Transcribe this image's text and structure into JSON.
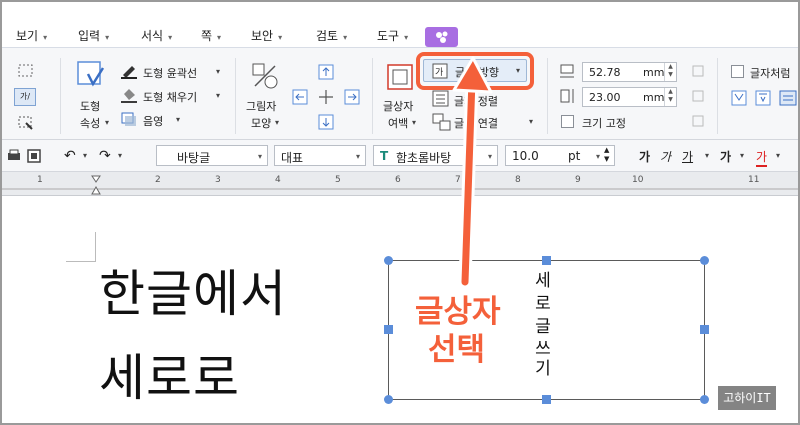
{
  "menu": {
    "items": [
      "보기",
      "입력",
      "서식",
      "쪽",
      "보안",
      "검토",
      "도구"
    ],
    "magic_icon": "magic-wand-icon"
  },
  "ribbon": {
    "shape_props": {
      "line1": "도형",
      "line2": "속성"
    },
    "outline_label": "도형 윤곽선",
    "fill_label": "도형 채우기",
    "shadow_label": "음영",
    "picture_shape": {
      "line1": "그림자",
      "line2": "모양"
    },
    "textbox_margin": {
      "line1": "글상자",
      "line2": "여백"
    },
    "text_direction_label": "글자 방향",
    "text_align_label": "글자 정렬",
    "text_link_label": "글자 연결",
    "width": {
      "value": "52.78",
      "unit": "mm"
    },
    "height": {
      "value": "23.00",
      "unit": "mm"
    },
    "fix_size_label": "크기 고정",
    "treat_as_char_label": "글자처럼"
  },
  "format": {
    "style": "바탕글",
    "language": "대표",
    "font": "함초롬바탕",
    "size": "10.0",
    "size_unit": "pt",
    "char_a": "가",
    "char_b": "가",
    "char_c": "가",
    "char_d": "가",
    "char_e": "가"
  },
  "ruler": {
    "numbers": [
      "1",
      "2",
      "3",
      "4",
      "5",
      "6",
      "7",
      "8",
      "9",
      "10",
      "11"
    ]
  },
  "document": {
    "line1": "한글에서",
    "line2": "세로로",
    "vertical_chars": [
      "세",
      "로",
      "글",
      "쓰",
      "기"
    ]
  },
  "annotation": {
    "line1": "글상자",
    "line2": "선택"
  },
  "watermark": "고하이IT",
  "colors": {
    "annotation": "#f4603a",
    "handle": "#5b8dd9",
    "magic": "#a86ee2"
  }
}
